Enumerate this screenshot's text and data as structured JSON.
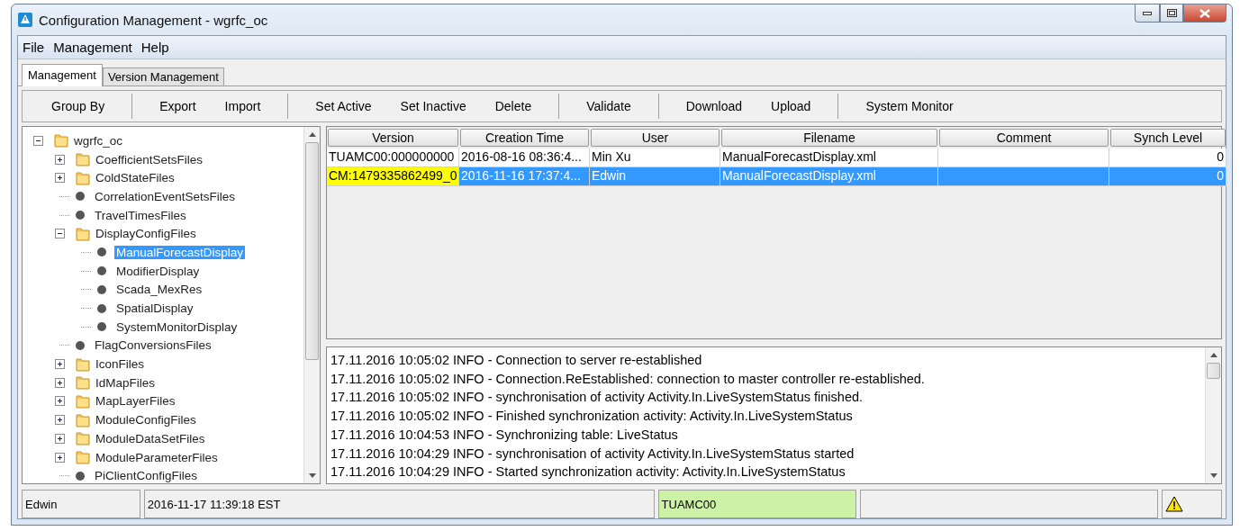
{
  "window": {
    "title": "Configuration Management - wgrfc_oc"
  },
  "menu": [
    "File",
    "Management",
    "Help"
  ],
  "tabs": [
    {
      "label": "Management",
      "selected": true
    },
    {
      "label": "Version Management",
      "selected": false
    }
  ],
  "toolbar": [
    [
      "Group By"
    ],
    [
      "Export",
      "Import"
    ],
    [
      "Set Active",
      "Set Inactive",
      "Delete"
    ],
    [
      "Validate"
    ],
    [
      "Download",
      "Upload"
    ],
    [
      "System Monitor"
    ]
  ],
  "tree": [
    {
      "label": "wgrfc_oc",
      "kind": "folder",
      "expanded": true,
      "selected": false,
      "children": [
        {
          "label": "CoefficientSetsFiles",
          "kind": "folder",
          "expanded": false,
          "selected": false
        },
        {
          "label": "ColdStateFiles",
          "kind": "folder",
          "expanded": false,
          "selected": false
        },
        {
          "label": "CorrelationEventSetsFiles",
          "kind": "leaf",
          "selected": false
        },
        {
          "label": "TravelTimesFiles",
          "kind": "leaf",
          "selected": false
        },
        {
          "label": "DisplayConfigFiles",
          "kind": "folder",
          "expanded": true,
          "selected": false,
          "children": [
            {
              "label": "ManualForecastDisplay",
              "kind": "leaf",
              "selected": true
            },
            {
              "label": "ModifierDisplay",
              "kind": "leaf",
              "selected": false
            },
            {
              "label": "Scada_MexRes",
              "kind": "leaf",
              "selected": false
            },
            {
              "label": "SpatialDisplay",
              "kind": "leaf",
              "selected": false
            },
            {
              "label": "SystemMonitorDisplay",
              "kind": "leaf",
              "selected": false
            }
          ]
        },
        {
          "label": "FlagConversionsFiles",
          "kind": "leaf",
          "selected": false
        },
        {
          "label": "IconFiles",
          "kind": "folder",
          "expanded": false,
          "selected": false
        },
        {
          "label": "IdMapFiles",
          "kind": "folder",
          "expanded": false,
          "selected": false
        },
        {
          "label": "MapLayerFiles",
          "kind": "folder",
          "expanded": false,
          "selected": false
        },
        {
          "label": "ModuleConfigFiles",
          "kind": "folder",
          "expanded": false,
          "selected": false
        },
        {
          "label": "ModuleDataSetFiles",
          "kind": "folder",
          "expanded": false,
          "selected": false
        },
        {
          "label": "ModuleParameterFiles",
          "kind": "folder",
          "expanded": false,
          "selected": false
        },
        {
          "label": "PiClientConfigFiles",
          "kind": "leaf",
          "selected": false
        }
      ]
    }
  ],
  "table": {
    "columns": [
      "Version",
      "Creation Time",
      "User",
      "Filename",
      "Comment",
      "Synch Level"
    ],
    "rows": [
      {
        "cells": [
          "TUAMC00:000000000",
          "2016-08-16 08:36:4...",
          "Min Xu",
          "ManualForecastDisplay.xml",
          "",
          "0"
        ],
        "selected": false,
        "version_highlighted": false
      },
      {
        "cells": [
          "CM:1479335862499_0",
          "2016-11-16 17:37:4...",
          "Edwin",
          "ManualForecastDisplay.xml",
          "",
          "0"
        ],
        "selected": true,
        "version_highlighted": true
      }
    ]
  },
  "log": [
    "17.11.2016 10:05:02 INFO - Connection to server re-established",
    "17.11.2016 10:05:02 INFO - Connection.ReEstablished: connection to master controller re-established.",
    "17.11.2016 10:05:02 INFO - synchronisation of activity Activity.In.LiveSystemStatus finished.",
    "17.11.2016 10:05:02 INFO - Finished synchronization activity: Activity.In.LiveSystemStatus",
    "17.11.2016 10:04:53 INFO - Synchronizing table: LiveStatus",
    "17.11.2016 10:04:29 INFO - synchronisation of activity Activity.In.LiveSystemStatus started",
    "17.11.2016 10:04:29 INFO - Started synchronization activity: Activity.In.LiveSystemStatus"
  ],
  "status_bar": [
    {
      "text": "Edwin",
      "highlighted": false
    },
    {
      "text": "2016-11-17 11:39:18 EST",
      "highlighted": false
    },
    {
      "text": "TUAMC00",
      "highlighted": true
    },
    {
      "highlighted": false
    }
  ],
  "status_warning": true
}
